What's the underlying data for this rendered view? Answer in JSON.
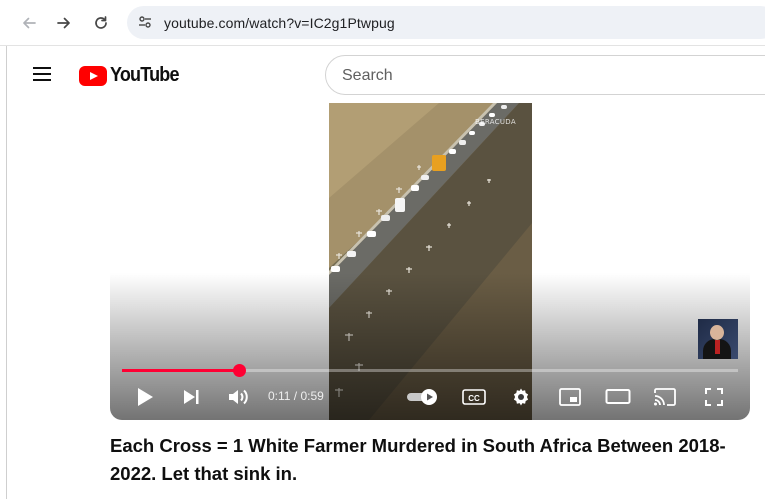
{
  "browser": {
    "url": "youtube.com/watch?v=IC2g1Ptwpug",
    "back_icon": "arrow-left-icon",
    "forward_icon": "arrow-right-icon",
    "reload_icon": "reload-icon",
    "site_info_icon": "tune-icon"
  },
  "header": {
    "logo_text": "YouTube",
    "search_placeholder": "Search",
    "brand_color": "#ff0000"
  },
  "player": {
    "watermark": "BERACUDA",
    "current_time": "0:11",
    "duration": "0:59",
    "time_text": "0:11 / 0:59",
    "progress_fraction": 0.19,
    "accent_color": "#ff0033",
    "autoplay_on": true,
    "controls": [
      "play-icon",
      "next-icon",
      "volume-icon",
      "autoplay-toggle-icon",
      "subtitles-icon",
      "settings-icon",
      "miniplayer-icon",
      "theater-mode-icon",
      "cast-icon",
      "fullscreen-icon"
    ]
  },
  "video": {
    "title": "Each Cross = 1 White Farmer Murdered in South Africa Between 2018-2022. Let that sink in."
  }
}
